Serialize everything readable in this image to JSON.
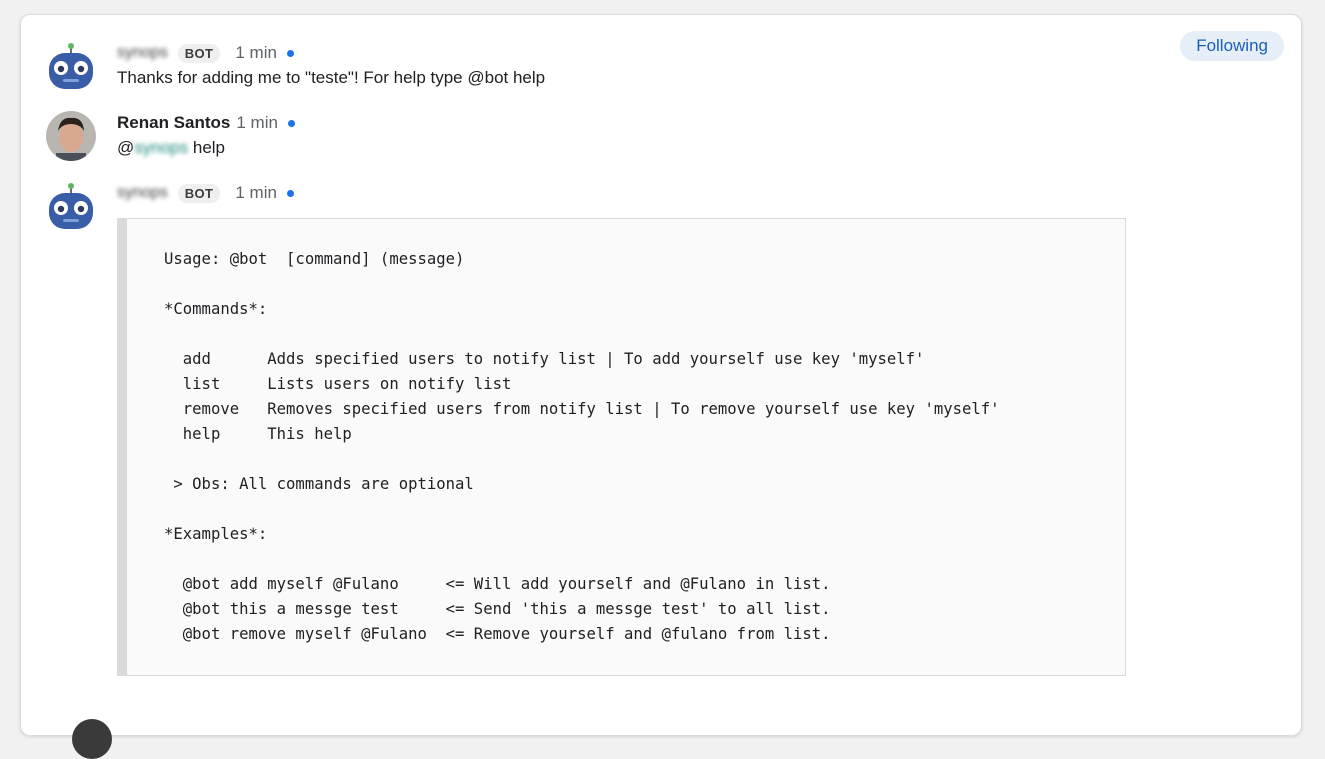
{
  "header": {
    "follow_label": "Following"
  },
  "messages": [
    {
      "author": "synops",
      "badge": "BOT",
      "time": "1 min",
      "text": "Thanks for adding me to \"teste\"! For help type @bot help"
    },
    {
      "author": "Renan Santos",
      "time": "1 min",
      "mention_prefix": "@",
      "mention": "synops",
      "text": "help"
    },
    {
      "author": "synops",
      "badge": "BOT",
      "time": "1 min",
      "code_lines": [
        "Usage: @bot  [command] (message)",
        "",
        "*Commands*:",
        "",
        "  add      Adds specified users to notify list | To add yourself use key 'myself'",
        "  list     Lists users on notify list",
        "  remove   Removes specified users from notify list | To remove yourself use key 'myself'",
        "  help     This help",
        "",
        " > Obs: All commands are optional",
        "",
        "*Examples*:",
        "",
        "  @bot add myself @Fulano     <= Will add yourself and @Fulano in list.",
        "  @bot this a messge test     <= Send 'this a messge test' to all list.",
        "  @bot remove myself @Fulano  <= Remove yourself and @fulano from list."
      ]
    }
  ],
  "colors": {
    "accent": "#1a73e8",
    "follow_bg": "#e6eef8",
    "follow_text": "#1b5fb8"
  },
  "icons": {
    "bot_avatar": "robot-avatar-icon",
    "user_avatar": "user-avatar"
  }
}
